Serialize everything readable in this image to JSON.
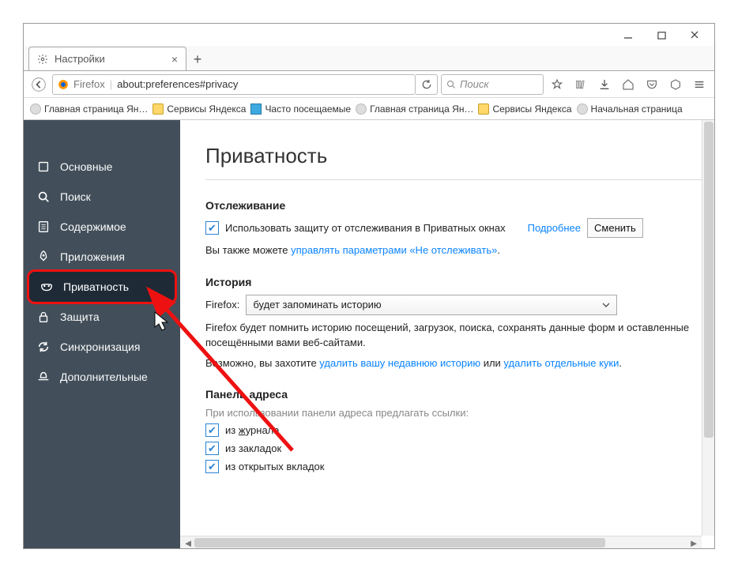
{
  "window": {
    "tab_title": "Настройки",
    "new_tab_aria": "+"
  },
  "urlbar": {
    "identity": "Firefox",
    "url": "about:preferences#privacy",
    "search_placeholder": "Поиск"
  },
  "bookmarks": [
    {
      "label": "Главная страница Ян…",
      "icon": "globe"
    },
    {
      "label": "Сервисы Яндекса",
      "icon": "folder"
    },
    {
      "label": "Часто посещаемые",
      "icon": "yfav"
    },
    {
      "label": "Главная страница Ян…",
      "icon": "globe"
    },
    {
      "label": "Сервисы Яндекса",
      "icon": "folder"
    },
    {
      "label": "Начальная страница",
      "icon": "globe"
    }
  ],
  "sidebar": {
    "items": [
      {
        "label": "Основные",
        "icon": "square"
      },
      {
        "label": "Поиск",
        "icon": "search"
      },
      {
        "label": "Содержимое",
        "icon": "doc"
      },
      {
        "label": "Приложения",
        "icon": "rocket"
      },
      {
        "label": "Приватность",
        "icon": "mask",
        "selected": true
      },
      {
        "label": "Защита",
        "icon": "lock"
      },
      {
        "label": "Синхронизация",
        "icon": "sync"
      },
      {
        "label": "Дополнительные",
        "icon": "hat"
      }
    ]
  },
  "page": {
    "title": "Приватность",
    "tracking": {
      "heading": "Отслеживание",
      "checkbox_label": "Использовать защиту от отслеживания в Приватных окнах",
      "more": "Подробнее",
      "change": "Сменить",
      "dnt_pre": "Вы также можете ",
      "dnt_link": "управлять параметрами «Не отслеживать»",
      "dnt_post": "."
    },
    "history": {
      "heading": "История",
      "prefix": "Firefox:",
      "dropdown": "будет запоминать историю",
      "desc": "Firefox будет помнить историю посещений, загрузок, поиска, сохранять данные форм и оставленные посещёнными вами веб-сайтами.",
      "maybe_pre": "Возможно, вы захотите ",
      "link1": "удалить вашу недавнюю историю",
      "mid": " или ",
      "link2": "удалить отдельные куки",
      "post": "."
    },
    "addressbar": {
      "heading": "Панель адреса",
      "desc": "При использовании панели адреса предлагать ссылки:",
      "opts": [
        {
          "pre": "из ",
          "u": "ж",
          "rest": "урнала"
        },
        {
          "pre": "из закладок",
          "u": "",
          "rest": ""
        },
        {
          "pre": "из открытых вкладок",
          "u": "",
          "rest": ""
        }
      ]
    }
  }
}
